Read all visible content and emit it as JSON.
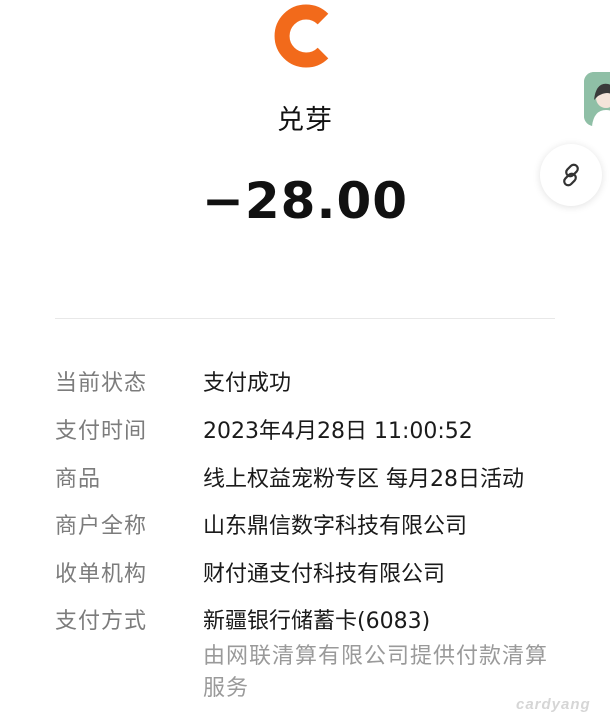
{
  "merchant": {
    "name": "兑芽",
    "logo_icon": "orange-c-logo-icon",
    "logo_color": "#F26A1B"
  },
  "amount": "−28.00",
  "details": [
    {
      "label": "当前状态",
      "value": "支付成功"
    },
    {
      "label": "支付时间",
      "value": "2023年4月28日 11:00:52"
    },
    {
      "label": "商品",
      "value": "线上权益宠粉专区 每月28日活动"
    },
    {
      "label": "商户全称",
      "value": "山东鼎信数字科技有限公司"
    },
    {
      "label": "收单机构",
      "value": "财付通支付科技有限公司"
    },
    {
      "label": "支付方式",
      "value": "新疆银行储蓄卡(6083)",
      "note": "由网联清算有限公司提供付款清算服务"
    }
  ],
  "floating": {
    "avatar_icon": "avatar-icon",
    "link_icon": "link-icon"
  },
  "watermark": "cardyang"
}
